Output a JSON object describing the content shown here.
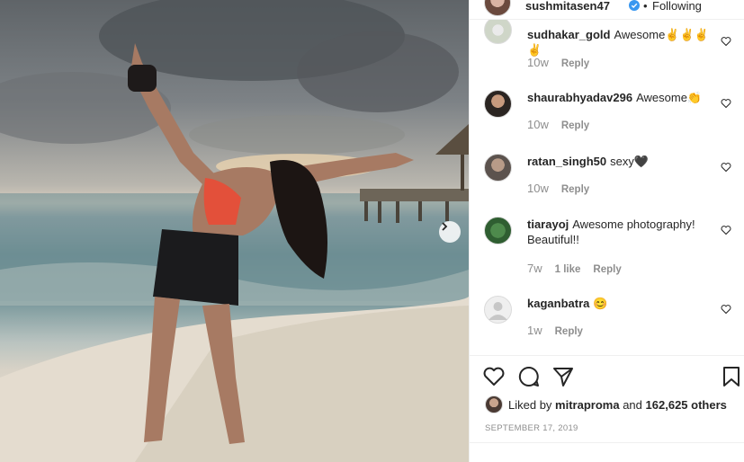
{
  "post": {
    "username": "sushmitasen47",
    "separator": "•",
    "follow_status": "Following",
    "verified_icon": "verified-badge-icon"
  },
  "comments": [
    {
      "username": "sudhakar_gold",
      "text": "Awesome✌️✌️✌️✌️",
      "time": "10w",
      "reply": "Reply",
      "likes": ""
    },
    {
      "username": "shaurabhyadav296",
      "text": "Awesome👏",
      "time": "10w",
      "reply": "Reply",
      "likes": ""
    },
    {
      "username": "ratan_singh50",
      "text": "sexy🖤",
      "time": "10w",
      "reply": "Reply",
      "likes": ""
    },
    {
      "username": "tiarayoj",
      "text": "Awesome photography! Beautiful!!",
      "time": "7w",
      "reply": "Reply",
      "likes": "1 like"
    },
    {
      "username": "kaganbatra",
      "text": "😊",
      "time": "1w",
      "reply": "Reply",
      "likes": ""
    }
  ],
  "likes": {
    "prefix": "Liked by",
    "user": "mitraproma",
    "middle": "and",
    "count": "162,625 others"
  },
  "date": "SEPTEMBER 17, 2019",
  "colors": {
    "text": "#262626",
    "muted": "#8e8e8e",
    "verified": "#3897f0",
    "border": "#efefef"
  }
}
